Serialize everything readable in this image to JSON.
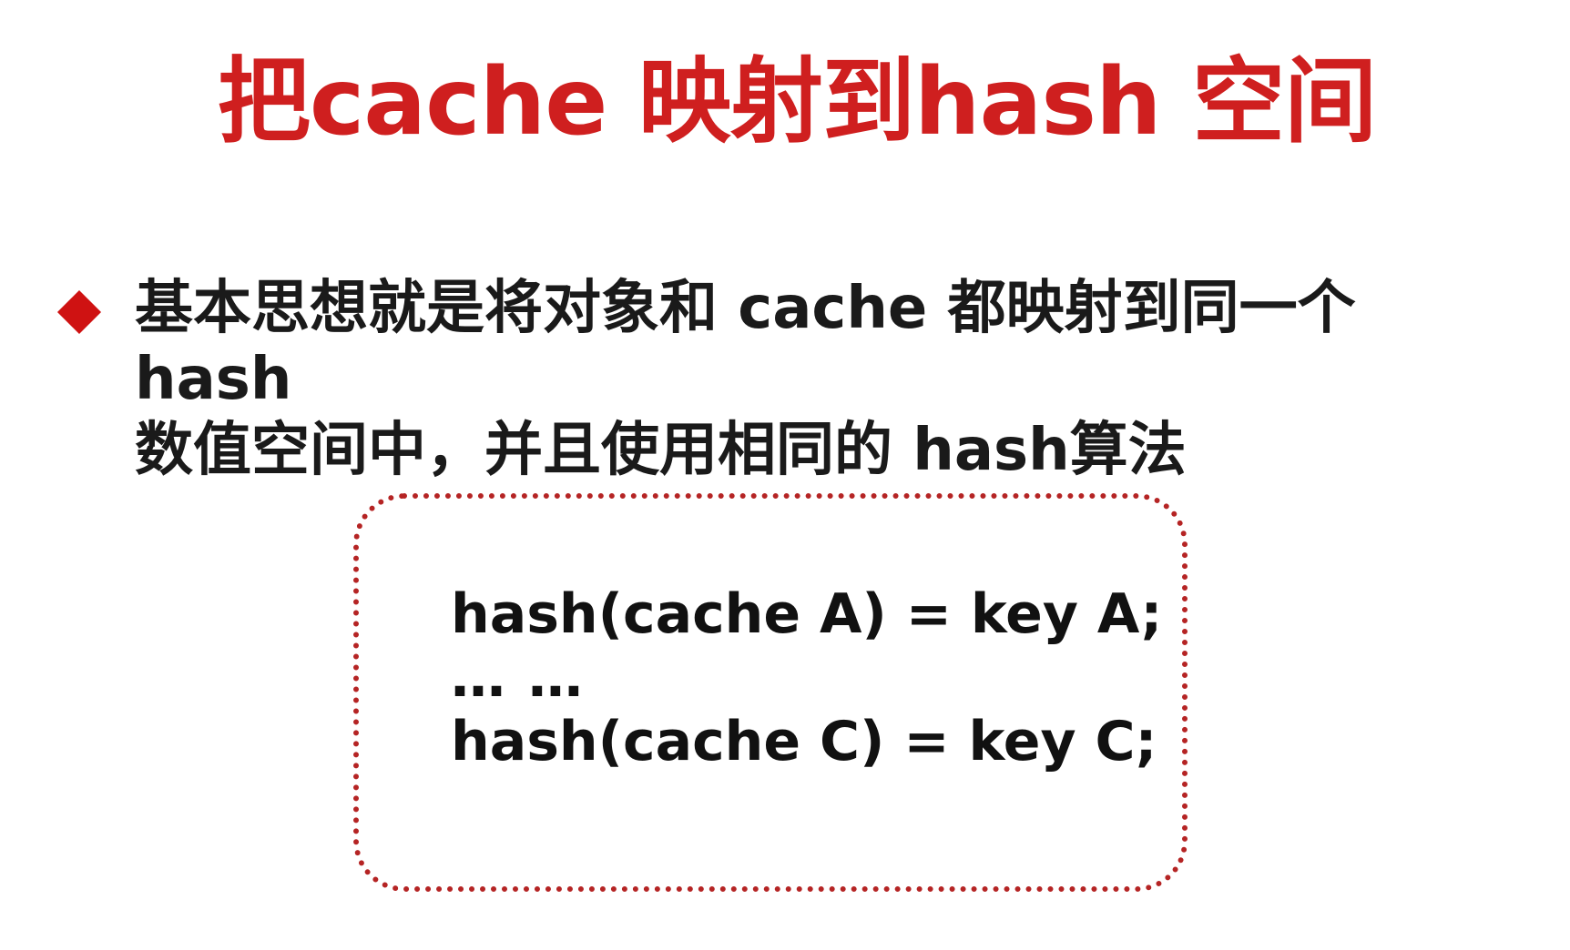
{
  "slide": {
    "title": "把cache 映射到hash 空间",
    "bullet": {
      "line1": "基本思想就是将对象和 cache 都映射到同一个 hash",
      "line2": "数值空间中，并且使用相同的 hash算法"
    },
    "code": {
      "line1": "hash(cache A) = key A;",
      "line2": "… …",
      "line3": "hash(cache C) = key C;"
    }
  },
  "colors": {
    "title": "#cf1f1f",
    "bullet_marker": "#cf1212",
    "box_border": "#b52424",
    "text": "#1a1a1a"
  }
}
